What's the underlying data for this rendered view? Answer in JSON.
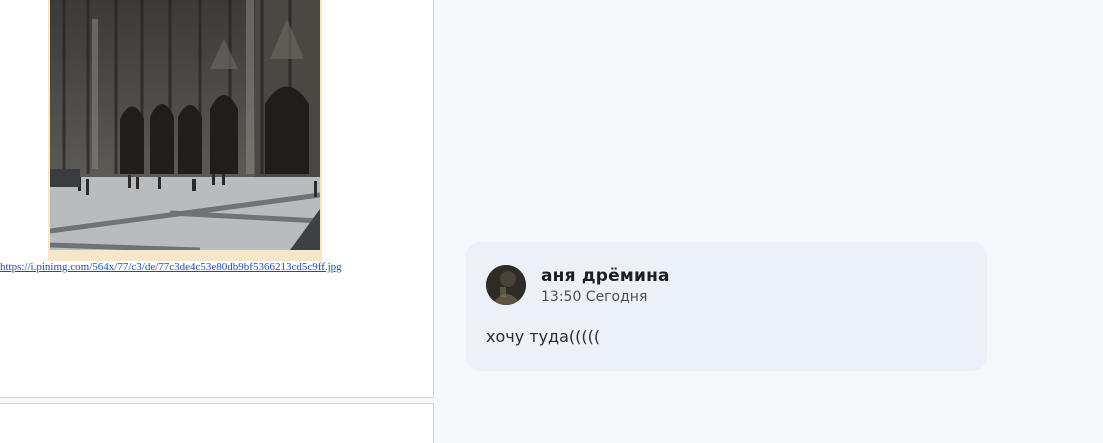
{
  "post": {
    "image_alt": "cathedral photo",
    "image_link": "https://i.pinimg.com/564x/77/c3/de/77c3de4c53e80db9bf5366213cd5c9ff.jpg"
  },
  "comment": {
    "author": "аня дрёмина",
    "time": "13:50 Сегодня",
    "text": "хочу туда((((("
  },
  "colors": {
    "page_bg": "#f7f8fb",
    "card_bg": "#ecf0f8",
    "link": "#1a4bbd"
  }
}
